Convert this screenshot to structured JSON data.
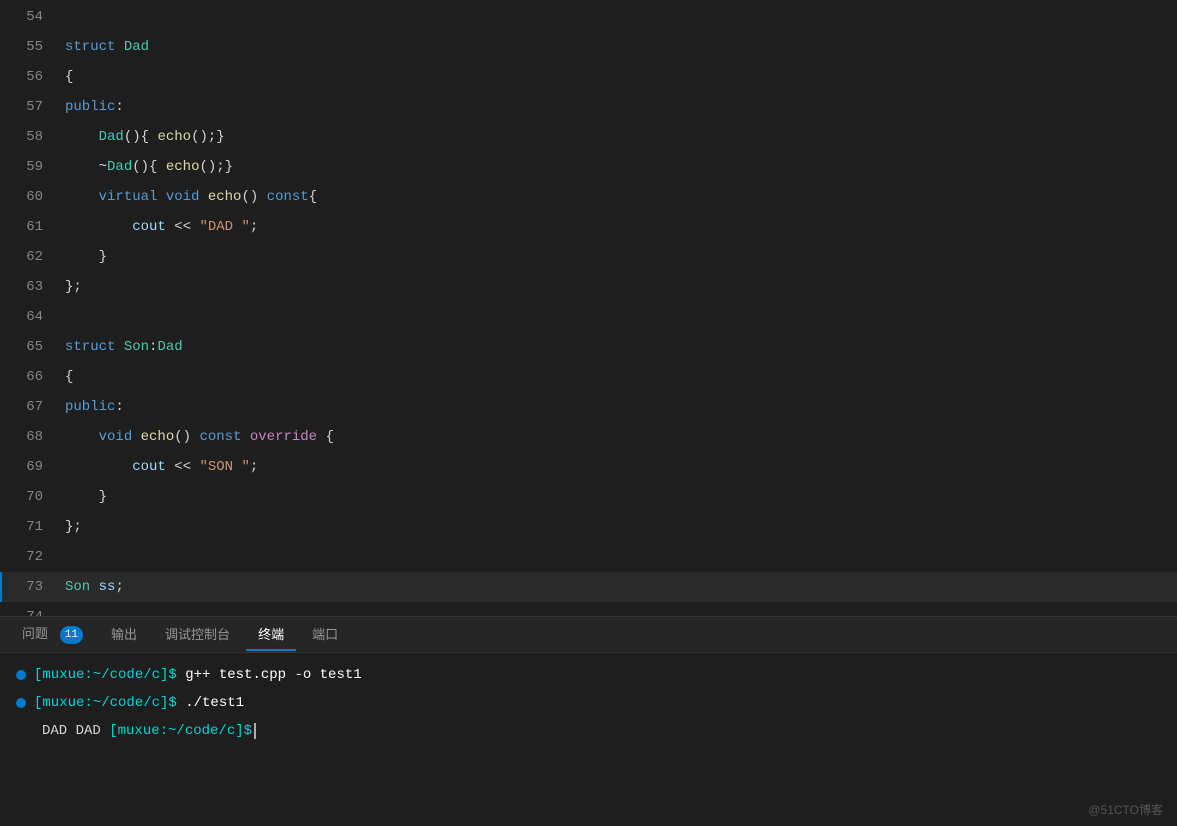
{
  "editor": {
    "lines": [
      {
        "num": "54",
        "content": "",
        "highlighted": false
      },
      {
        "num": "55",
        "content": "struct Dad",
        "highlighted": false
      },
      {
        "num": "56",
        "content": "{",
        "highlighted": false
      },
      {
        "num": "57",
        "content": "public:",
        "highlighted": false
      },
      {
        "num": "58",
        "content": "    Dad(){ echo();}",
        "highlighted": false
      },
      {
        "num": "59",
        "content": "    ~Dad(){ echo();}",
        "highlighted": false
      },
      {
        "num": "60",
        "content": "    virtual void echo() const{",
        "highlighted": false
      },
      {
        "num": "61",
        "content": "        cout << \"DAD \";",
        "highlighted": false
      },
      {
        "num": "62",
        "content": "    }",
        "highlighted": false
      },
      {
        "num": "63",
        "content": "};",
        "highlighted": false
      },
      {
        "num": "64",
        "content": "",
        "highlighted": false
      },
      {
        "num": "65",
        "content": "struct Son:Dad",
        "highlighted": false
      },
      {
        "num": "66",
        "content": "{",
        "highlighted": false
      },
      {
        "num": "67",
        "content": "public:",
        "highlighted": false
      },
      {
        "num": "68",
        "content": "    void echo() const override {",
        "highlighted": false
      },
      {
        "num": "69",
        "content": "        cout << \"SON \";",
        "highlighted": false
      },
      {
        "num": "70",
        "content": "    }",
        "highlighted": false
      },
      {
        "num": "71",
        "content": "};",
        "highlighted": false
      },
      {
        "num": "72",
        "content": "",
        "highlighted": false
      },
      {
        "num": "73",
        "content": "Son ss;",
        "highlighted": true
      },
      {
        "num": "74",
        "content": "",
        "highlighted": false
      }
    ]
  },
  "panel": {
    "tabs": [
      {
        "label": "问题",
        "active": false,
        "badge": "11"
      },
      {
        "label": "输出",
        "active": false,
        "badge": ""
      },
      {
        "label": "调试控制台",
        "active": false,
        "badge": ""
      },
      {
        "label": "终端",
        "active": true,
        "badge": ""
      },
      {
        "label": "端口",
        "active": false,
        "badge": ""
      }
    ]
  },
  "terminal": {
    "lines": [
      {
        "dot": "blue",
        "prompt": "[muxue:~/code/c]$",
        "cmd": " g++ test.cpp -o test1"
      },
      {
        "dot": "blue",
        "prompt": "[muxue:~/code/c]$",
        "cmd": " ./test1"
      },
      {
        "dot": "none",
        "prompt": "DAD DAD [muxue:~/code/c]$",
        "cmd": "",
        "cursor": true
      }
    ]
  },
  "watermark": "@51CTO博客"
}
